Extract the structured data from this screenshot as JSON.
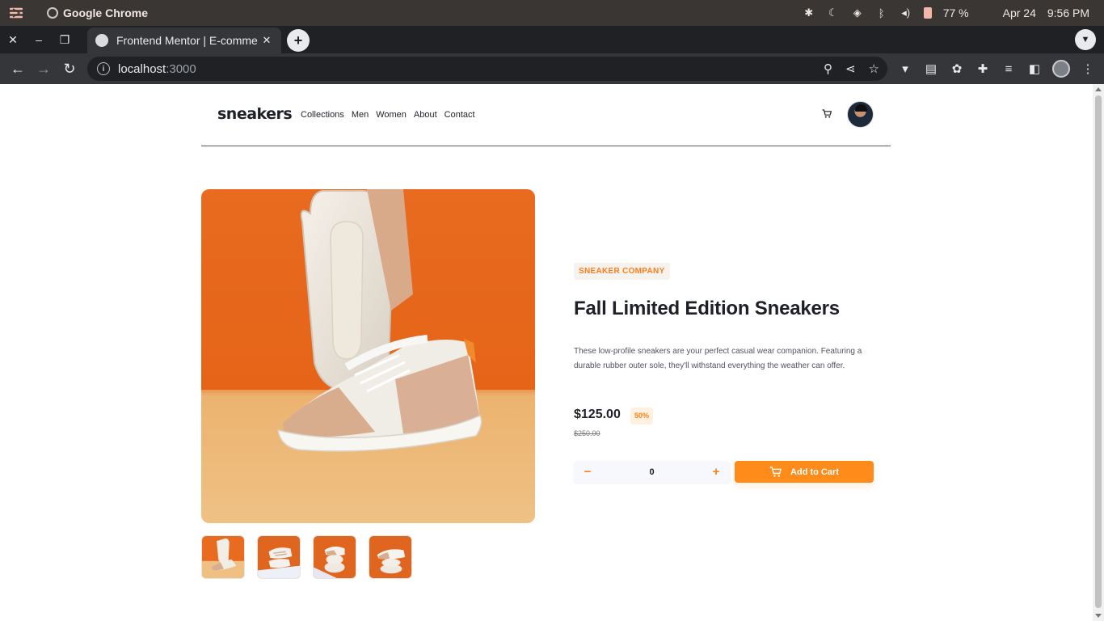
{
  "os_bar": {
    "app_name": "Google Chrome",
    "battery": "77 %",
    "date": "Apr 24",
    "time": "9:56 PM"
  },
  "browser": {
    "tab_title": "Frontend Mentor | E-comme",
    "url_host": "localhost",
    "url_port": ":3000"
  },
  "site": {
    "logo": "sneakers",
    "nav": [
      "Collections",
      "Men",
      "Women",
      "About",
      "Contact"
    ]
  },
  "product": {
    "company": "SNEAKER COMPANY",
    "title": "Fall Limited Edition Sneakers",
    "description": "These low-profile sneakers are your perfect casual wear companion. Featuring a durable rubber outer sole, they'll withstand everything the weather can offer.",
    "price": "$125.00",
    "discount": "50%",
    "old_price": "$250.00",
    "quantity": "0",
    "add_to_cart": "Add to Cart",
    "qty_minus": "−",
    "qty_plus": "+"
  },
  "colors": {
    "accent": "#ff7d1a",
    "dark": "#1d2026"
  }
}
